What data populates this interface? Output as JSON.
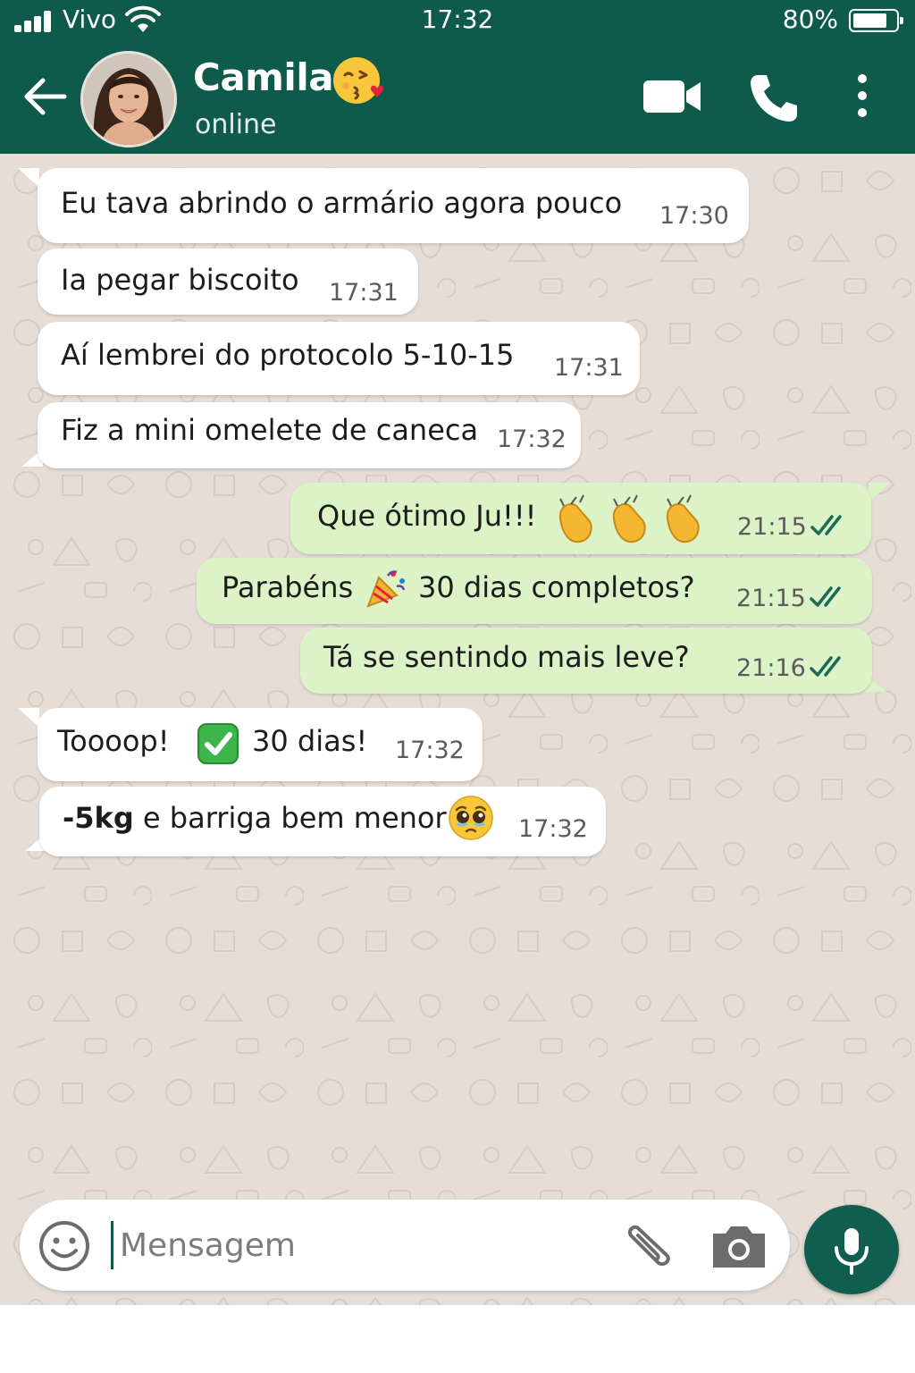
{
  "status_bar": {
    "carrier": "Vivo",
    "time": "17:32",
    "battery": "80%",
    "battery_level": 0.8
  },
  "header": {
    "contact_name": "Camila",
    "contact_emoji": "face-blowing-kiss-emoji",
    "status": "online",
    "icons": [
      "back-arrow-icon",
      "video-call-icon",
      "phone-icon",
      "more-options-icon"
    ]
  },
  "messages": [
    {
      "direction": "in",
      "text": "Eu tava abrindo o armário agora pouco",
      "time": "17:30"
    },
    {
      "direction": "in",
      "text": "Ia pegar biscoito",
      "time": "17:31"
    },
    {
      "direction": "in",
      "text": "Aí lembrei do protocolo 5-10-15",
      "time": "17:31"
    },
    {
      "direction": "in",
      "text": "Fiz a mini omelete de caneca",
      "time": "17:32"
    },
    {
      "direction": "out",
      "text": "Que ótimo Ju!!!",
      "emoji": "clapping-hands-emoji x3",
      "time": "21:15",
      "status": "read"
    },
    {
      "direction": "out",
      "text_before": "Parabéns",
      "emoji": "party-popper-emoji",
      "text_after": "30 dias completos?",
      "time": "21:15",
      "status": "read"
    },
    {
      "direction": "out",
      "text": "Tá se sentindo mais leve?",
      "time": "21:16",
      "status": "read"
    },
    {
      "direction": "in",
      "text_before": "Toooop!",
      "emoji": "check-mark-button-emoji",
      "text_after": "30 dias!",
      "time": "17:32"
    },
    {
      "direction": "in",
      "bold": "-5kg",
      "text": " e barriga bem menor",
      "emoji": "pleading-face-emoji",
      "time": "17:32"
    }
  ],
  "composer": {
    "placeholder": "Mensagem",
    "icons": [
      "emoji-icon",
      "paperclip-icon",
      "camera-icon",
      "microphone-icon"
    ]
  },
  "colors": {
    "header": "#0e5a4b",
    "chat_background": "#e5ddd6",
    "incoming_bubble": "#ffffff",
    "outgoing_bubble": "#dcf3c8",
    "read_ticks": "#1b6b57",
    "mic_button": "#0f5e4e"
  }
}
